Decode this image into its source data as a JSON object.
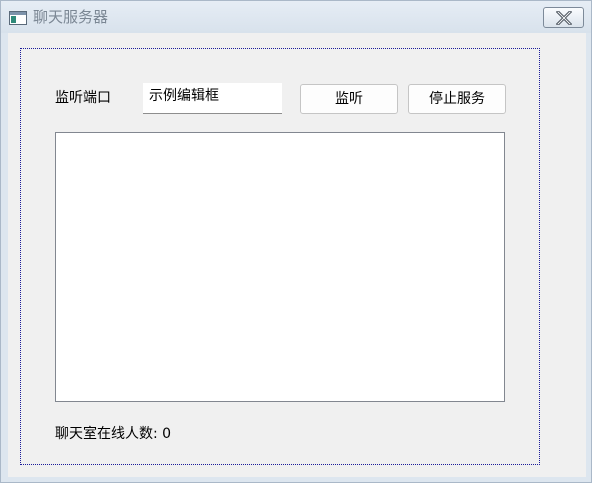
{
  "window": {
    "title": "聊天服务器",
    "icon": "app-window-icon",
    "close_icon": "close-icon"
  },
  "form": {
    "port_label": "监听端口",
    "port_value": "示例编辑框",
    "listen_button": "监听",
    "stop_button": "停止服务",
    "message_log": "",
    "online_label": "聊天室在线人数: 0"
  },
  "colors": {
    "client_background": "#f0f0f0",
    "titlebar": "#dde6ef",
    "focus_border": "#1c1c9a"
  }
}
